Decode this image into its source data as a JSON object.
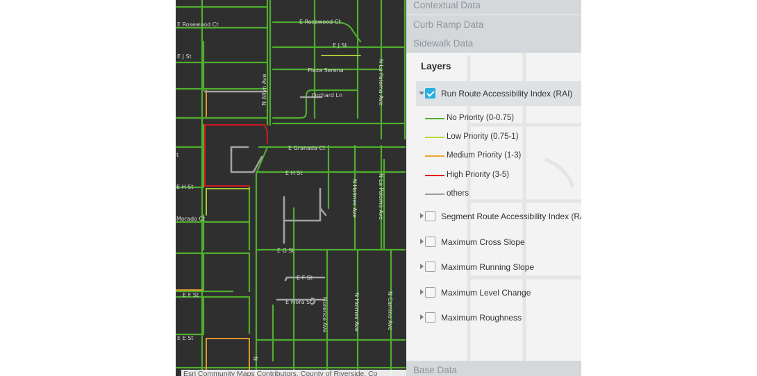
{
  "map": {
    "streets": {
      "rosewood_ct": "E Rosewood Ct",
      "rosewood_ct_2": "E Rosewood Ct",
      "j_st": "E J St",
      "j_st_2": "E J St",
      "plaza_serena": "Plaza Serena",
      "orchard_ln": "Orchard Ln",
      "la_paloma_ave": "N La Paloma Ave",
      "la_paloma_ave_2": "N La Paloma Ave",
      "allyn_ave": "N Allyn Ave",
      "granada_ct": "E Granada Ct",
      "h_st": "E H St",
      "h_st_2": "E H St",
      "holmes_ave": "N Holmes Ave",
      "holmes_ave_2": "N Holmes Ave",
      "morado_ct": "Morado Ct",
      "g_st": "E G St",
      "f_st": "E F St",
      "f_st_2": "E F St",
      "flora_st": "E Flora St",
      "florence_ave": "Florence Ave",
      "e_st": "E E St",
      "camino_ave": "N Camino Ave",
      "n_label": "N",
      "ct_label": "t"
    },
    "attribution": "Esri Community Maps Contributors, County of Riverside, Co"
  },
  "panel": {
    "sections": {
      "contextual": "Contextual Data",
      "curb_ramp": "Curb Ramp Data",
      "sidewalk": "Sidewalk Data",
      "base": "Base Data"
    },
    "layers_title": "Layers",
    "active_layer": {
      "label": "Run Route Accessibility Index (RAI)",
      "checked": true,
      "legend": [
        {
          "label": "No Priority (0-0.75)",
          "color": "#4fae2d"
        },
        {
          "label": "Low Priority (0.75-1)",
          "color": "#b7dc3a"
        },
        {
          "label": "Medium Priority (1-3)",
          "color": "#f2a32d"
        },
        {
          "label": "High Priority (3-5)",
          "color": "#e2171f"
        },
        {
          "label": "others",
          "color": "#9a9a9a"
        }
      ]
    },
    "layers": [
      {
        "label": "Segment Route Accessibility Index (RAI)",
        "checked": false
      },
      {
        "label": "Maximum Cross Slope",
        "checked": false
      },
      {
        "label": "Maximum Running Slope",
        "checked": false
      },
      {
        "label": "Maximum Level Change",
        "checked": false
      },
      {
        "label": "Maximum Roughness",
        "checked": false
      }
    ]
  },
  "colors": {
    "map_background": "#2f2f2f",
    "no_priority": "#4fae2d",
    "low_priority": "#b7dc3a",
    "medium_priority": "#f2a32d",
    "high_priority": "#e2171f",
    "others": "#9a9a9a",
    "checkbox_accent": "#29aee0",
    "section_header": "#d5d8da"
  }
}
